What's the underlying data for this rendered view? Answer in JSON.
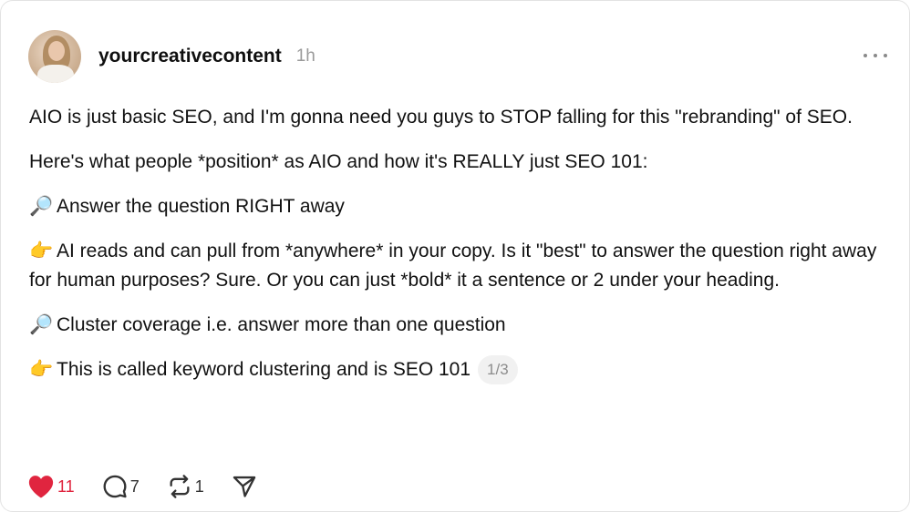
{
  "post": {
    "username": "yourcreativecontent",
    "time": "1h",
    "paragraphs": [
      "AIO is just basic SEO, and I'm gonna need you guys to STOP falling for this \"rebranding\" of SEO.",
      "Here's what people *position* as AIO and how it's REALLY just SEO 101:"
    ],
    "items": [
      {
        "icon": "magnifier-icon",
        "glyph": "🔎",
        "text": "Answer the question RIGHT away"
      },
      {
        "icon": "pointing-hand-icon",
        "glyph": "👉",
        "text": "AI reads and can pull from *anywhere* in your copy. Is it \"best\" to answer the question right away for human purposes? Sure. Or you can just *bold* it a sentence or 2 under your heading."
      },
      {
        "icon": "magnifier-icon",
        "glyph": "🔎",
        "text": "Cluster coverage i.e. answer more than one question"
      },
      {
        "icon": "pointing-hand-icon",
        "glyph": "👉",
        "text": "This is called keyword clustering and is SEO 101"
      }
    ],
    "pager": "1/3"
  },
  "actions": {
    "likes": "11",
    "comments": "7",
    "reposts": "1"
  },
  "colors": {
    "like": "#e0253f",
    "muted": "#9a9a9a"
  }
}
